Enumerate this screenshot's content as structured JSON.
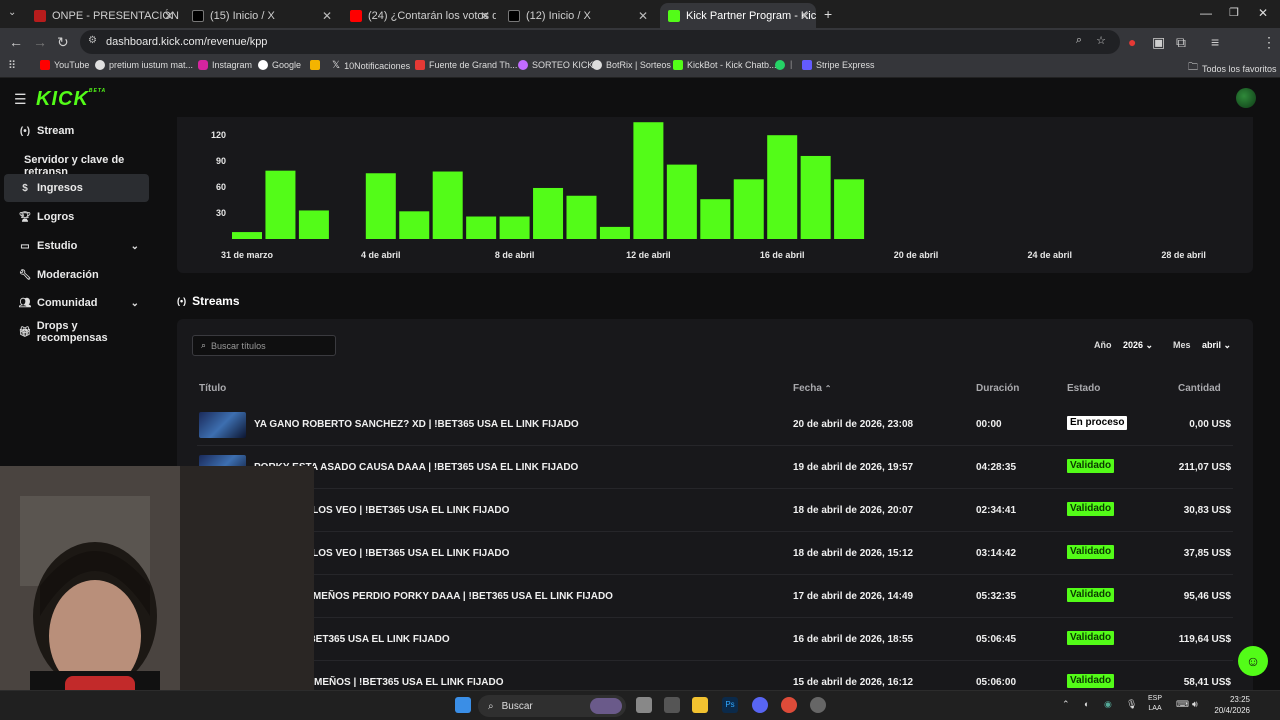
{
  "browser": {
    "tabs": [
      {
        "label": "ONPE - PRESENTACIÓN DE RES",
        "color": "#b71c1c"
      },
      {
        "label": "(15) Inicio / X",
        "color": "#000000"
      },
      {
        "label": "(24) ¿Contarán los votos de act",
        "color": "#ff0000"
      },
      {
        "label": "(12) Inicio / X",
        "color": "#000000"
      },
      {
        "label": "Kick Partner Program - Kick Da",
        "color": "#53fc18"
      }
    ],
    "url": "dashboard.kick.com/revenue/kpp",
    "bookmarks": [
      "YouTube",
      "pretium iustum mat...",
      "Instagram",
      "Google",
      "10Notificaciones",
      "Fuente de Grand Th...",
      "SORTEO KICK",
      "BotRix | Sorteos",
      "KickBot - Kick Chatb...",
      "Stripe Express"
    ],
    "all_bookmarks": "Todos los favoritos"
  },
  "app": {
    "logo": "KICK",
    "logo_badge": "BETA",
    "sidebar": [
      {
        "label": "Stream",
        "icon": "broadcast-icon"
      },
      {
        "label": "Ingresos",
        "icon": "dollar-icon",
        "active": true
      },
      {
        "label": "Logros",
        "icon": "trophy-icon"
      },
      {
        "label": "Estudio",
        "icon": "film-icon",
        "expandable": true
      },
      {
        "label": "Moderación",
        "icon": "wrench-icon"
      },
      {
        "label": "Comunidad",
        "icon": "users-icon",
        "expandable": true
      },
      {
        "label": "Drops y recompensas",
        "icon": "gift-icon"
      }
    ],
    "sidebar_sub": "Servidor y clave de retransn",
    "accent": "#53fc18"
  },
  "chart_data": {
    "type": "bar",
    "y_ticks": [
      30,
      60,
      90,
      120
    ],
    "ylim": [
      0,
      140
    ],
    "x_tick_labels": [
      "31 de marzo",
      "4 de abril",
      "8 de abril",
      "12 de abril",
      "16 de abril",
      "20 de abril",
      "24 de abril",
      "28 de abril"
    ],
    "categories": [
      "31 mar",
      "1 abr",
      "2 abr",
      "3 abr",
      "4 abr",
      "5 abr",
      "6 abr",
      "7 abr",
      "8 abr",
      "9 abr",
      "10 abr",
      "11 abr",
      "12 abr",
      "13 abr",
      "14 abr",
      "15 abr",
      "16 abr",
      "17 abr",
      "18 abr"
    ],
    "values": [
      8,
      79,
      33,
      0,
      76,
      32,
      78,
      26,
      26,
      59,
      50,
      14,
      135,
      86,
      46,
      69,
      120,
      96,
      69
    ],
    "color": "#53fc18"
  },
  "streams": {
    "heading": "Streams",
    "search_placeholder": "Buscar títulos",
    "year_label": "Año",
    "year_value": "2026",
    "month_label": "Mes",
    "month_value": "abril",
    "columns": {
      "title": "Título",
      "date": "Fecha",
      "duration": "Duración",
      "status": "Estado",
      "amount": "Cantidad"
    },
    "rows": [
      {
        "title": "YA GANO ROBERTO SANCHEZ? XD | !BET365 USA EL LINK FIJADO",
        "date": "20 de abril de 2026, 23:08",
        "duration": "00:00",
        "status": "En proceso",
        "amount": "0,00 US$"
      },
      {
        "title": "PORKY ESTA ASADO CAUSA DAAA | !BET365 USA EL LINK FIJADO",
        "date": "19 de abril de 2026, 19:57",
        "duration": "04:28:35",
        "status": "Validado",
        "amount": "211,07 US$"
      },
      {
        "title": "SOSTADOS LOS VEO | !BET365 USA EL LINK FIJADO",
        "date": "18 de abril de 2026, 20:07",
        "duration": "02:34:41",
        "status": "Validado",
        "amount": "30,83 US$"
      },
      {
        "title": "SOSTADOS LOS VEO | !BET365 USA EL LINK FIJADO",
        "date": "18 de abril de 2026, 15:12",
        "duration": "03:14:42",
        "status": "Validado",
        "amount": "37,85 US$"
      },
      {
        "title": "LES VEO LEMEÑOS PERDIO PORKY DAAA | !BET365 USA EL LINK FIJADO",
        "date": "17 de abril de 2026, 14:49",
        "duration": "05:32:35",
        "status": "Validado",
        "amount": "95,46 US$"
      },
      {
        "title": "LEMEÑO | !BET365 USA EL LINK FIJADO",
        "date": "16 de abril de 2026, 18:55",
        "duration": "05:06:45",
        "status": "Validado",
        "amount": "119,64 US$"
      },
      {
        "title": "LOS VEO LEMEÑOS | !BET365 USA EL LINK FIJADO",
        "date": "15 de abril de 2026, 16:12",
        "duration": "05:06:00",
        "status": "Validado",
        "amount": "58,41 US$"
      }
    ]
  },
  "taskbar": {
    "search": "Buscar",
    "lang_top": "ESP",
    "lang_bottom": "LAA",
    "time": "23:25",
    "date": "20/4/2026"
  }
}
